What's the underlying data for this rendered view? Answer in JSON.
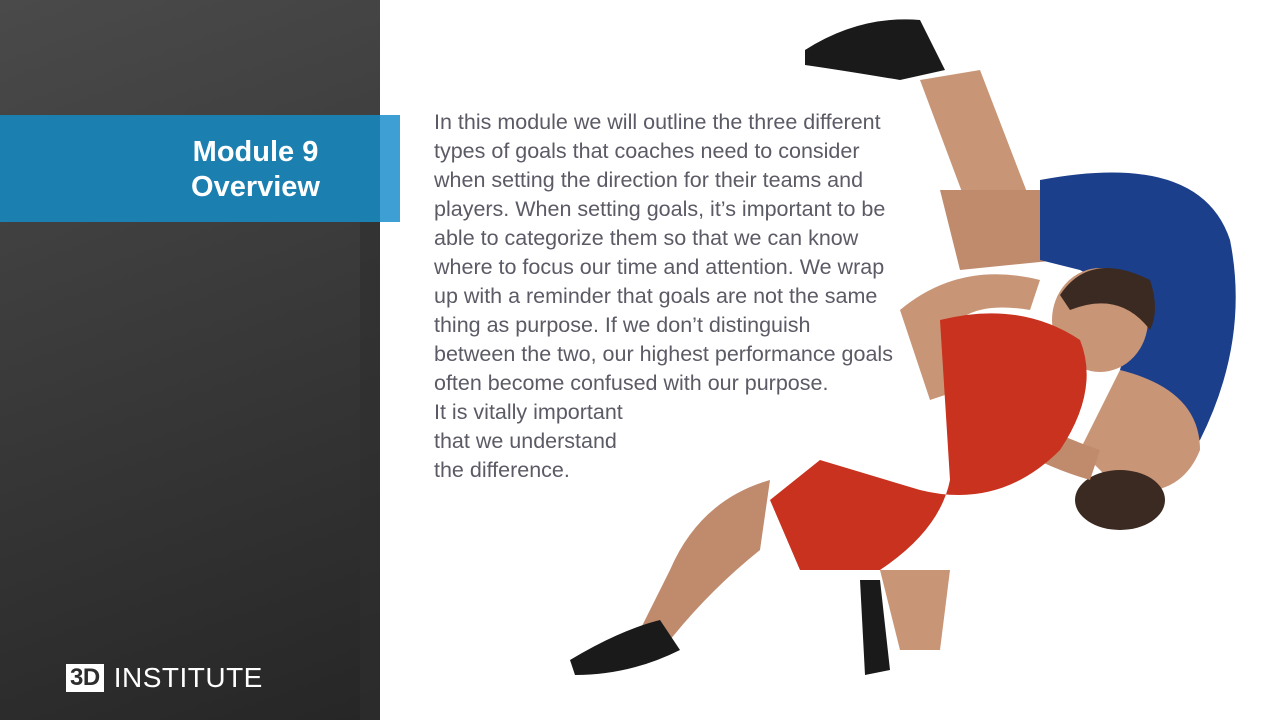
{
  "slide": {
    "title_line1": "Module 9",
    "title_line2": "Overview",
    "body_paragraph": "In this module we will outline the three different types of goals that coaches need to consider when setting the direction for their teams and players. When setting goals, it’s important to be able to categorize them so that we can know where to focus our time and attention. We wrap up with a reminder that goals are not the same thing as purpose. If we don’t distinguish between the two, our highest performance goals often become confused with our purpose.",
    "body_line_a": "It is vitally important",
    "body_line_b": "that we understand",
    "body_line_c": "the difference."
  },
  "logo": {
    "box_text": "3D",
    "word_text": "INSTITUTE"
  },
  "photo": {
    "icon": "wrestlers-photo",
    "colors": {
      "red_singlet": "#c8321e",
      "blue_singlet": "#1c3f8c",
      "skin": "#c99577"
    }
  },
  "colors": {
    "accent_blue": "#1b7fb0",
    "accent_blue_light": "#3d9fd3",
    "sidebar_dark": "#3a3a3a",
    "body_text": "#5b5b66"
  }
}
